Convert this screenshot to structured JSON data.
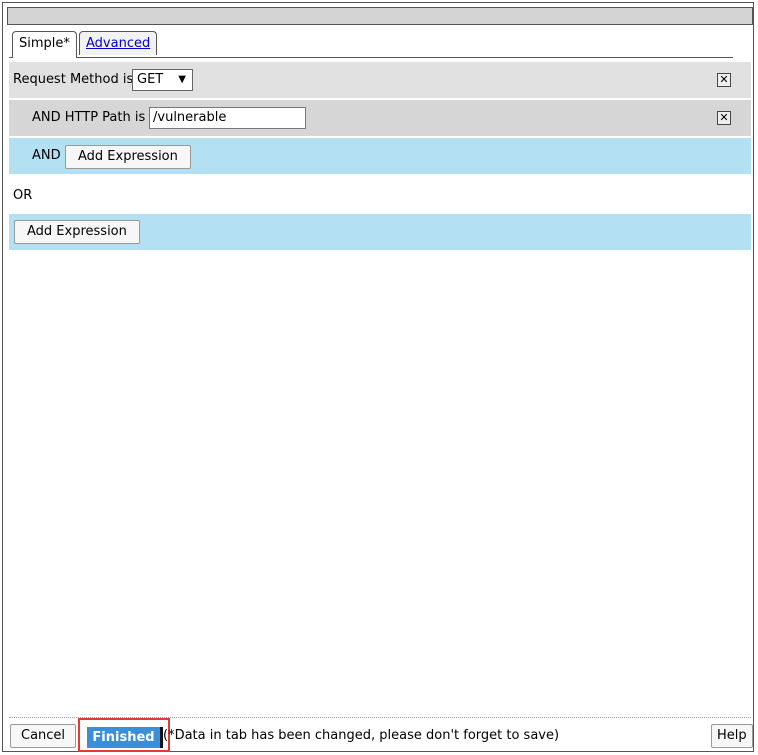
{
  "tabs": [
    {
      "label": "Simple*"
    },
    {
      "label": "Advanced"
    }
  ],
  "rules": {
    "method_label": "Request Method is",
    "method_value": "GET",
    "path_label": "AND HTTP Path is",
    "path_value": "/vulnerable",
    "and_label": "AND",
    "add_expression_label": "Add Expression",
    "or_label": "OR",
    "add_expression_or_label": "Add Expression",
    "remove_glyph": "✕"
  },
  "footer": {
    "cancel_label": "Cancel",
    "finished_label": "Finished",
    "status_text": "(*Data in tab has been changed, please don't forget to save)",
    "help_label": "Help"
  }
}
